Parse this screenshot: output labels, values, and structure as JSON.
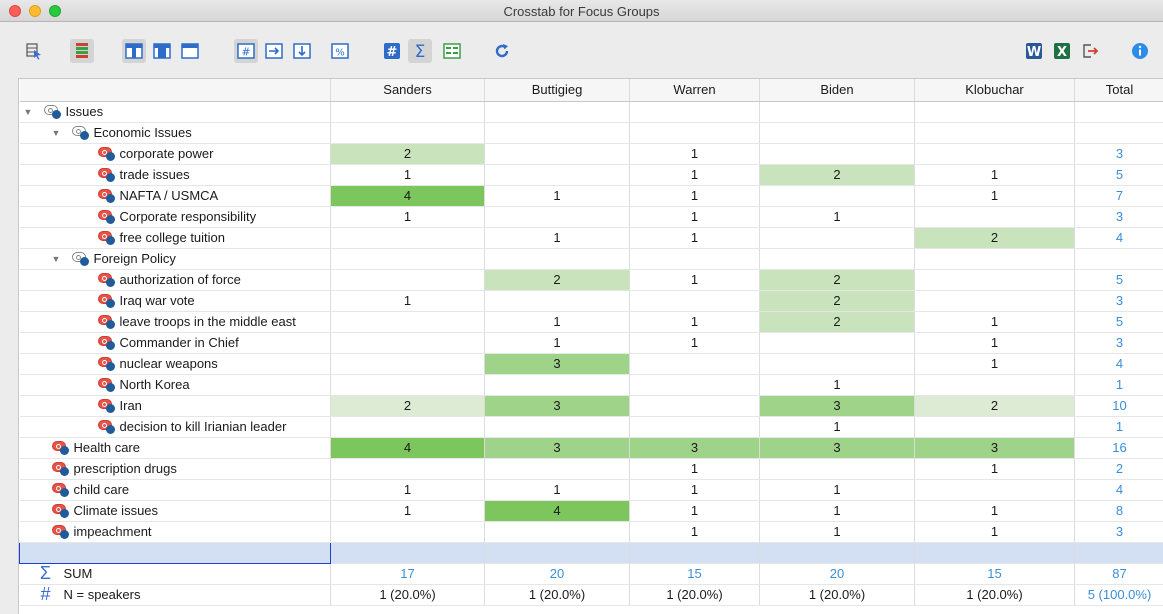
{
  "window": {
    "title": "Crosstab for Focus Groups"
  },
  "columns": [
    "Sanders",
    "Buttigieg",
    "Warren",
    "Biden",
    "Klobuchar",
    "Total"
  ],
  "rows": [
    {
      "label": "Issues",
      "level": 0,
      "kind": "group",
      "cells": [
        "",
        "",
        "",
        "",
        "",
        ""
      ]
    },
    {
      "label": "Economic Issues",
      "level": 1,
      "kind": "group",
      "cells": [
        "",
        "",
        "",
        "",
        "",
        ""
      ]
    },
    {
      "label": "corporate power",
      "level": 2,
      "kind": "code",
      "cells": [
        "2",
        "",
        "1",
        "",
        "",
        "3"
      ],
      "heat": [
        2,
        0,
        0,
        0,
        0
      ]
    },
    {
      "label": "trade issues",
      "level": 2,
      "kind": "code",
      "cells": [
        "1",
        "",
        "1",
        "2",
        "1",
        "5"
      ],
      "heat": [
        0,
        0,
        0,
        2,
        0
      ]
    },
    {
      "label": "NAFTA / USMCA",
      "level": 2,
      "kind": "code",
      "cells": [
        "4",
        "1",
        "1",
        "",
        "1",
        "7"
      ],
      "heat": [
        4,
        0,
        0,
        0,
        0
      ]
    },
    {
      "label": "Corporate responsibility",
      "level": 2,
      "kind": "code",
      "cells": [
        "1",
        "",
        "1",
        "1",
        "",
        "3"
      ],
      "heat": [
        0,
        0,
        0,
        0,
        0
      ]
    },
    {
      "label": "free college tuition",
      "level": 2,
      "kind": "code",
      "cells": [
        "",
        "1",
        "1",
        "",
        "2",
        "4"
      ],
      "heat": [
        0,
        0,
        0,
        0,
        2
      ]
    },
    {
      "label": "Foreign Policy",
      "level": 1,
      "kind": "group",
      "cells": [
        "",
        "",
        "",
        "",
        "",
        ""
      ]
    },
    {
      "label": "authorization of force",
      "level": 2,
      "kind": "code",
      "cells": [
        "",
        "2",
        "1",
        "2",
        "",
        "5"
      ],
      "heat": [
        0,
        2,
        0,
        2,
        0
      ]
    },
    {
      "label": "Iraq war vote",
      "level": 2,
      "kind": "code",
      "cells": [
        "1",
        "",
        "",
        "2",
        "",
        "3"
      ],
      "heat": [
        0,
        0,
        0,
        2,
        0
      ]
    },
    {
      "label": "leave troops in the middle east",
      "level": 2,
      "kind": "code",
      "cells": [
        "",
        "1",
        "1",
        "2",
        "1",
        "5"
      ],
      "heat": [
        0,
        0,
        0,
        2,
        0
      ]
    },
    {
      "label": "Commander in Chief",
      "level": 2,
      "kind": "code",
      "cells": [
        "",
        "1",
        "1",
        "",
        "1",
        "3"
      ],
      "heat": [
        0,
        0,
        0,
        0,
        0
      ]
    },
    {
      "label": "nuclear weapons",
      "level": 2,
      "kind": "code",
      "cells": [
        "",
        "3",
        "",
        "",
        "1",
        "4"
      ],
      "heat": [
        0,
        3,
        0,
        0,
        0
      ]
    },
    {
      "label": "North Korea",
      "level": 2,
      "kind": "code",
      "cells": [
        "",
        "",
        "",
        "1",
        "",
        "1"
      ],
      "heat": [
        0,
        0,
        0,
        0,
        0
      ]
    },
    {
      "label": "Iran",
      "level": 2,
      "kind": "code",
      "cells": [
        "2",
        "3",
        "",
        "3",
        "2",
        "10"
      ],
      "heat": [
        1,
        3,
        0,
        3,
        1
      ]
    },
    {
      "label": "decision to kill Irianian leader",
      "level": 2,
      "kind": "code",
      "cells": [
        "",
        "",
        "",
        "1",
        "",
        "1"
      ],
      "heat": [
        0,
        0,
        0,
        0,
        0
      ]
    },
    {
      "label": "Health care",
      "level": 1,
      "kind": "code",
      "cells": [
        "4",
        "3",
        "3",
        "3",
        "3",
        "16"
      ],
      "heat": [
        4,
        3,
        3,
        3,
        3
      ]
    },
    {
      "label": "prescription drugs",
      "level": 1,
      "kind": "code",
      "cells": [
        "",
        "",
        "1",
        "",
        "1",
        "2"
      ],
      "heat": [
        0,
        0,
        0,
        0,
        0
      ]
    },
    {
      "label": "child care",
      "level": 1,
      "kind": "code",
      "cells": [
        "1",
        "1",
        "1",
        "1",
        "",
        "4"
      ],
      "heat": [
        0,
        0,
        0,
        0,
        0
      ]
    },
    {
      "label": "Climate issues",
      "level": 1,
      "kind": "code",
      "cells": [
        "1",
        "4",
        "1",
        "1",
        "1",
        "8"
      ],
      "heat": [
        0,
        4,
        0,
        0,
        0
      ]
    },
    {
      "label": "impeachment",
      "level": 1,
      "kind": "code",
      "cells": [
        "",
        "",
        "1",
        "1",
        "1",
        "3"
      ],
      "heat": [
        0,
        0,
        0,
        0,
        0
      ]
    }
  ],
  "sum_row": {
    "label": "SUM",
    "cells": [
      "17",
      "20",
      "15",
      "20",
      "15",
      "87"
    ]
  },
  "n_row": {
    "label": "N = speakers",
    "cells": [
      "1 (20.0%)",
      "1 (20.0%)",
      "1 (20.0%)",
      "1 (20.0%)",
      "1 (20.0%)",
      "5 (100.0%)"
    ]
  },
  "colors": {
    "heat1": "#ddebd5",
    "heat2": "#c9e3bd",
    "heat3": "#9fd38a",
    "heat4": "#7dc65e",
    "link": "#3b8ed6",
    "selection": "#d3e0f3"
  },
  "toolbar_icons": [
    "cursor-select-icon",
    "stacked-bars-icon",
    "layout-top-icon",
    "layout-center-icon",
    "layout-bottom-icon",
    "hash-box-icon",
    "arrow-right-box-icon",
    "arrow-down-box-icon",
    "percent-box-icon",
    "hash-icon",
    "sigma-icon",
    "table-split-icon",
    "refresh-icon",
    "word-export-icon",
    "excel-export-icon",
    "export-arrow-icon",
    "info-icon"
  ]
}
